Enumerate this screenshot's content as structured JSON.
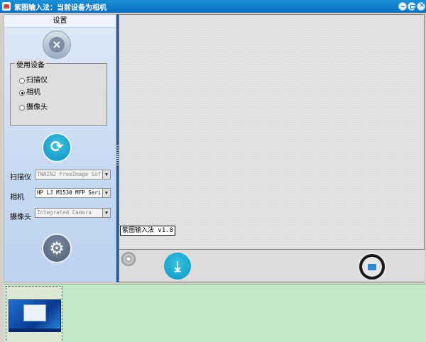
{
  "window": {
    "title": "紫图输入法：当前设备为相机"
  },
  "left_panel": {
    "header": "设置",
    "device_group": {
      "legend": "使用设备",
      "options": [
        {
          "label": "扫描仪",
          "checked": false
        },
        {
          "label": "相机",
          "checked": true
        },
        {
          "label": "摄像头",
          "checked": false
        }
      ]
    },
    "fields": [
      {
        "label": "扫描仪",
        "value": "TWAIN2 FreeImage Sof",
        "enabled": false
      },
      {
        "label": "相机",
        "value": "HP LJ M1530 MFP Seri",
        "enabled": true
      },
      {
        "label": "摄像头",
        "value": "Integrated Camera",
        "enabled": false
      }
    ]
  },
  "preview": {
    "version_label": "紫图输入法 v1.0"
  },
  "colors": {
    "titlebar": "#0a6fc0",
    "accent": "#0e8fc2",
    "thumb_area": "#c4e8c8"
  },
  "icons": {
    "close": "close-icon",
    "refresh": "refresh-icon",
    "settings": "gear-icon",
    "capture": "download-icon",
    "folder": "folder-icon",
    "disc": "disc-icon"
  }
}
